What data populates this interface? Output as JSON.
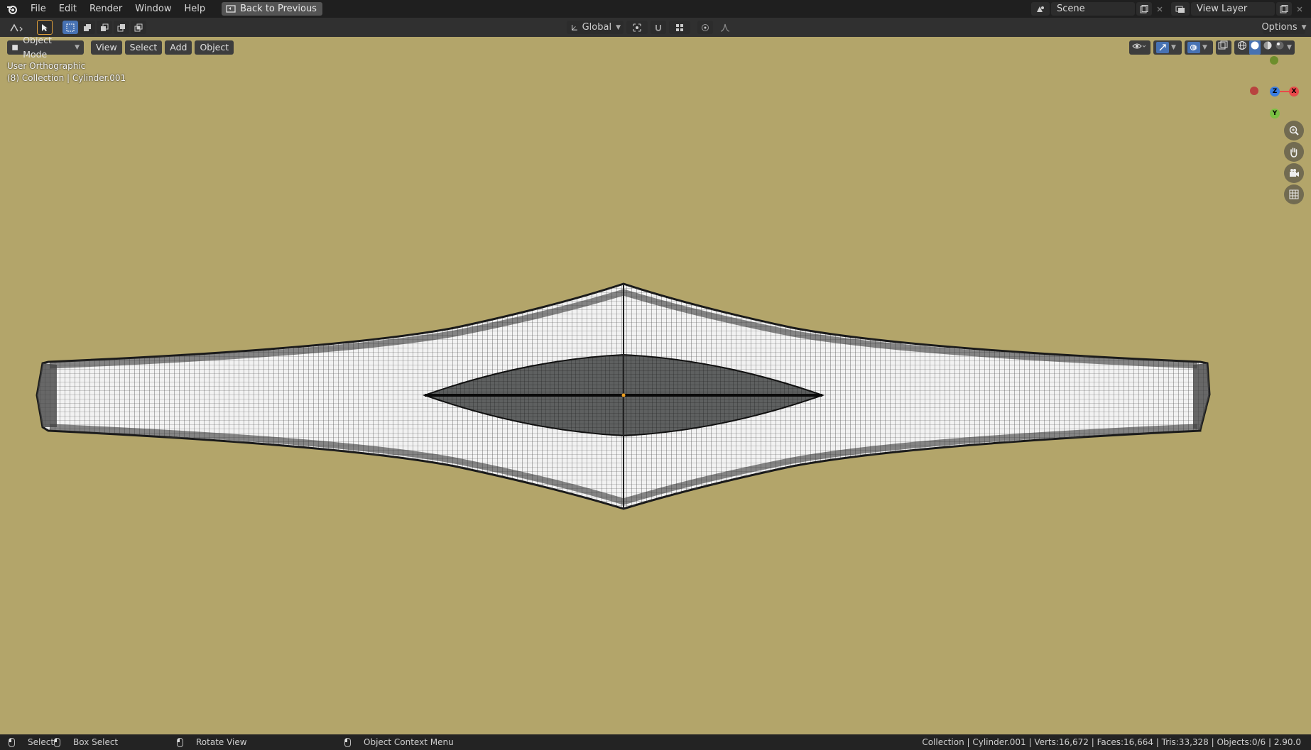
{
  "topbar": {
    "menu": [
      "File",
      "Edit",
      "Render",
      "Window",
      "Help"
    ],
    "back_label": "Back to Previous",
    "scene_label": "Scene",
    "view_layer_label": "View Layer"
  },
  "toolbar": {
    "transform_orientation": "Global",
    "options_label": "Options"
  },
  "viewport_header": {
    "mode_label": "Object Mode",
    "view_label": "View",
    "select_label": "Select",
    "add_label": "Add",
    "object_label": "Object"
  },
  "viewport": {
    "view_name": "User Orthographic",
    "collection_info": "(8) Collection | Cylinder.001",
    "gizmo_axes": {
      "x": "X",
      "y": "Y",
      "z": "Z"
    },
    "background_color": "#b3a56a"
  },
  "statusbar": {
    "select_label": "Select",
    "box_select_label": "Box Select",
    "rotate_label": "Rotate View",
    "context_menu_label": "Object Context Menu",
    "stats": "Collection | Cylinder.001 | Verts:16,672 | Faces:16,664 | Tris:33,328 | Objects:0/6 | 2.90.0"
  },
  "colors": {
    "axis_x": "#e84a4a",
    "axis_y": "#7bc043",
    "axis_z": "#3a7de0",
    "accent": "#4772b3"
  }
}
